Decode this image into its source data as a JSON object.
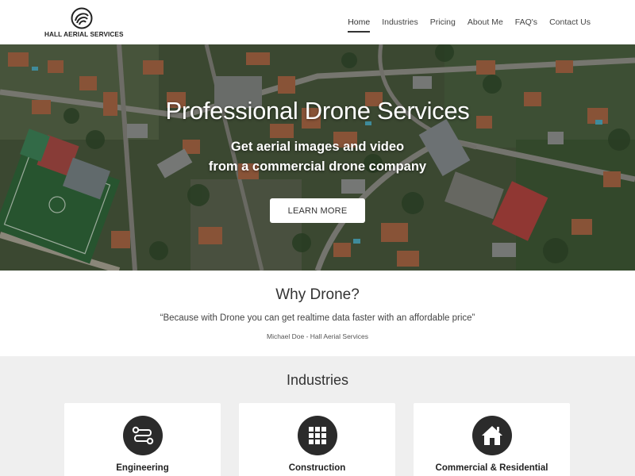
{
  "brand": {
    "name": "HALL AERIAL SERVICES",
    "logo_icon": "swirl-logo-icon"
  },
  "nav": {
    "items": [
      {
        "label": "Home",
        "active": true
      },
      {
        "label": "Industries",
        "active": false
      },
      {
        "label": "Pricing",
        "active": false
      },
      {
        "label": "About Me",
        "active": false
      },
      {
        "label": "FAQ's",
        "active": false
      },
      {
        "label": "Contact Us",
        "active": false
      }
    ]
  },
  "hero": {
    "title": "Professional Drone Services",
    "subtitle_line1": "Get aerial images and video",
    "subtitle_line2": "from a commercial drone company",
    "cta_label": "LEARN MORE"
  },
  "why": {
    "title": "Why Drone?",
    "quote": "“Because with Drone you can get realtime data faster with an affordable price”",
    "author": "Michael Doe - Hall Aerial Services"
  },
  "industries": {
    "title": "Industries",
    "cards": [
      {
        "label": "Engineering",
        "icon": "circuit-icon"
      },
      {
        "label": "Construction",
        "icon": "grid-icon"
      },
      {
        "label": "Commercial & Residential",
        "icon": "house-icon"
      }
    ]
  },
  "colors": {
    "icon_circle": "#2b2b2b",
    "section_bg": "#efefef",
    "accent": "#333333"
  }
}
